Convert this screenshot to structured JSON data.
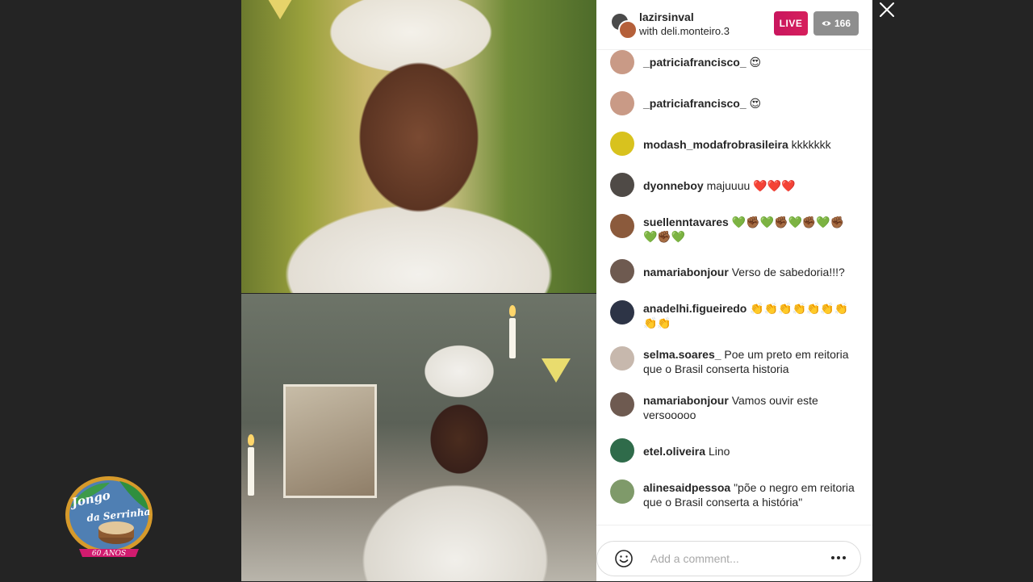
{
  "header": {
    "host": "lazirsinval",
    "with": "with deli.monteiro.3",
    "live": "LIVE",
    "viewers": "166"
  },
  "comments": [
    {
      "user": "_patriciafrancisco_",
      "text": "😍",
      "avatar": "#c99a86"
    },
    {
      "user": "_patriciafrancisco_",
      "text": "😍",
      "avatar": "#c99a86"
    },
    {
      "user": "modash_modafrobrasileira",
      "text": "kkkkkkk",
      "avatar": "#d8c21e"
    },
    {
      "user": "dyonneboy",
      "text": "majuuuu ❤️❤️❤️",
      "avatar": "#4f4a46"
    },
    {
      "user": "suellenntavares",
      "text": "💚✊🏾💚✊🏾💚✊🏾💚✊🏾💚✊🏾💚",
      "avatar": "#8b5a3c"
    },
    {
      "user": "namariabonjour",
      "text": "Verso de sabedoria!!!?",
      "avatar": "#6e5a50"
    },
    {
      "user": "anadelhi.figueiredo",
      "text": "👏👏👏👏👏👏👏👏👏",
      "avatar": "#2d3446"
    },
    {
      "user": "selma.soares_",
      "text": "Poe um preto em reitoria que o Brasil conserta historia",
      "avatar": "#c7b8ad"
    },
    {
      "user": "namariabonjour",
      "text": "Vamos ouvir este versooooo",
      "avatar": "#6e5a50"
    },
    {
      "user": "etel.oliveira",
      "text": "Lino",
      "avatar": "#2f6b4a"
    },
    {
      "user": "alinesaidpessoa",
      "text": "\"põe o negro em reitoria que o Brasil conserta a história\"",
      "avatar": "#7f9a6a"
    }
  ],
  "composer": {
    "placeholder": "Add a comment..."
  },
  "logo": {
    "line1": "Jongo",
    "line2": "da Serrinha",
    "years": "60 ANOS"
  },
  "colors": {
    "live": "#d31e5e",
    "viewers_badge": "#8e8e8e",
    "page_bg": "#242424"
  },
  "icons": [
    "close-icon",
    "eye-icon",
    "smiley-icon",
    "more-icon"
  ]
}
